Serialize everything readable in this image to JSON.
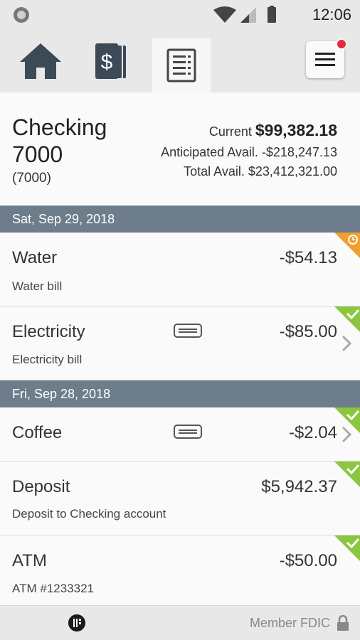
{
  "status_bar": {
    "time": "12:06"
  },
  "tabs": [
    {
      "name": "home",
      "icon": "home-icon"
    },
    {
      "name": "accounts",
      "icon": "dollar-cards-icon"
    },
    {
      "name": "transactions",
      "icon": "document-list-icon",
      "active": true
    }
  ],
  "menu": {
    "icon": "hamburger-menu-icon",
    "has_notification": true
  },
  "account": {
    "name": "Checking 7000",
    "number": "(7000)",
    "current_label": "Current",
    "current_value": "$99,382.18",
    "anticipated_label": "Anticipated Avail.",
    "anticipated_value": "-$218,247.13",
    "total_label": "Total Avail.",
    "total_value": "$23,412,321.00"
  },
  "groups": [
    {
      "date": "Sat, Sep 29, 2018",
      "transactions": [
        {
          "name": "Water",
          "description": "Water bill",
          "amount": "-$54.13",
          "status": "pending"
        },
        {
          "name": "Electricity",
          "description": "Electricity bill",
          "amount": "-$85.00",
          "status": "cleared",
          "has_memo": true
        }
      ]
    },
    {
      "date": "Fri, Sep 28, 2018",
      "transactions": [
        {
          "name": "Coffee",
          "description": "",
          "amount": "-$2.04",
          "status": "cleared",
          "has_memo": true
        },
        {
          "name": "Deposit",
          "description": "Deposit to Checking account",
          "amount": "$5,942.37",
          "status": "cleared"
        },
        {
          "name": "ATM",
          "description": "ATM #1233321",
          "amount": "-$50.00",
          "status": "cleared"
        }
      ]
    }
  ],
  "colors": {
    "pending": "#f0a030",
    "cleared": "#8cc63f",
    "date_header": "#6d7d8c"
  },
  "footer": {
    "text": "Member FDIC"
  }
}
